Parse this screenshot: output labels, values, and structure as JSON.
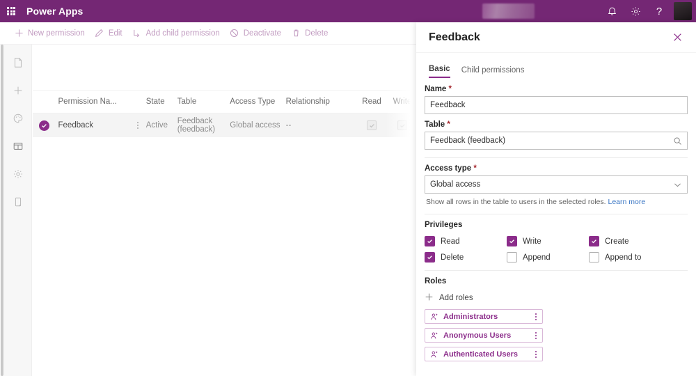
{
  "topbar": {
    "waffle_label": "waffle-menu",
    "brand": "Power Apps",
    "notifications_label": "Notifications",
    "settings_label": "Settings",
    "help_label": "?",
    "avatar_label": "Account manager"
  },
  "commandbar": {
    "items": [
      {
        "label": "New permission",
        "icon": "plus-icon"
      },
      {
        "label": "Edit",
        "icon": "pencil-icon"
      },
      {
        "label": "Add child permission",
        "icon": "add-child-icon"
      },
      {
        "label": "Deactivate",
        "icon": "block-icon"
      },
      {
        "label": "Delete",
        "icon": "trash-icon"
      }
    ]
  },
  "rail": {
    "items": [
      {
        "icon": "page-icon",
        "label": "Pages"
      },
      {
        "icon": "plus-icon",
        "label": "Add"
      },
      {
        "icon": "palette-icon",
        "label": "Theme"
      },
      {
        "icon": "layout-icon",
        "label": "Data"
      },
      {
        "icon": "gear-icon",
        "label": "Settings"
      },
      {
        "icon": "mobile-icon",
        "label": "Preview"
      }
    ]
  },
  "grid": {
    "columns": [
      "Permission Na...",
      "State",
      "Table",
      "Access Type",
      "Relationship",
      "Read",
      "Write"
    ],
    "rows": [
      {
        "name": "Feedback",
        "state": "Active",
        "table": "Feedback (feedback)",
        "access_type": "Global access",
        "relationship": "--",
        "read": true,
        "write": true,
        "selected": true
      }
    ]
  },
  "panel": {
    "title": "Feedback",
    "close_label": "Close",
    "tabs": [
      {
        "label": "Basic",
        "active": true
      },
      {
        "label": "Child permissions",
        "active": false
      }
    ],
    "fields": {
      "name": {
        "label": "Name",
        "required": "*",
        "value": "Feedback"
      },
      "table": {
        "label": "Table",
        "required": "*",
        "value": "Feedback (feedback)",
        "icon": "search-icon"
      },
      "access_type": {
        "label": "Access type",
        "required": "*",
        "value": "Global access",
        "icon": "chevron-down-icon"
      }
    },
    "hint": {
      "text": "Show all rows in the table to users in the selected roles.",
      "link": "Learn more"
    },
    "privileges": {
      "title": "Privileges",
      "items": [
        {
          "label": "Read",
          "checked": true
        },
        {
          "label": "Write",
          "checked": true
        },
        {
          "label": "Create",
          "checked": true
        },
        {
          "label": "Delete",
          "checked": true
        },
        {
          "label": "Append",
          "checked": false
        },
        {
          "label": "Append to",
          "checked": false
        }
      ]
    },
    "roles": {
      "title": "Roles",
      "add_label": "Add roles",
      "items": [
        {
          "label": "Administrators"
        },
        {
          "label": "Anonymous Users"
        },
        {
          "label": "Authenticated Users"
        }
      ]
    }
  },
  "colors": {
    "brand_purple": "#742774",
    "accent_purple": "#8b2c8a",
    "required_red": "#a4262c",
    "link_blue": "#3a76c4"
  }
}
